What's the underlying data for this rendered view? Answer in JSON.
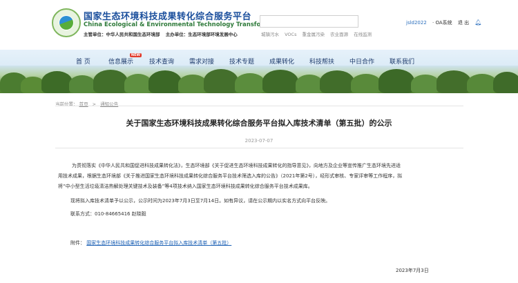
{
  "header": {
    "title_cn": "国家生态环境科技成果转化综合服务平台",
    "title_en": "China Ecological & Environmental Technology Transformation",
    "host_label": "主管单位：",
    "host_value": "中华人民共和国生态环境部",
    "organizer_label": "主办单位：",
    "organizer_value": "生态环境部环境发展中心",
    "search_placeholder": "",
    "hot_words": [
      "城镇污水",
      "VOCs",
      "重金属污染",
      "农业面源",
      "在线监测"
    ],
    "user": "jsld2022",
    "oa": "· OA系统",
    "logout": "退 出"
  },
  "nav": {
    "items": [
      "首 页",
      "信息展示",
      "技术查询",
      "需求对接",
      "技术专题",
      "成果转化",
      "科技帮扶",
      "中日合作",
      "联系我们"
    ],
    "new_badge": "NEW"
  },
  "breadcrumb": {
    "label": "当前位置：",
    "home": "首页",
    "arrow": ">",
    "current": "通知公告"
  },
  "article": {
    "title": "关于国家生态环境科技成果转化综合服务平台拟入库技术清单（第五批）的公示",
    "date": "2023-07-07",
    "p1_line1": "为贯彻落实《中华人民共和国促进科技成果转化法》，生态环境部《关于促进生态环境科技成果转化的指导意见》，向地方及企业等宣传推广生态环境先进适",
    "p1_line2": "用技术成果，根据生态环境部《关于推进国家生态环境科技成果转化综合服务平台技术筛选入库的公告》（2021年第2号），经形式审核、专家评审等工作程序，拟",
    "p1_line3": "将“中小型生活垃圾清洁热解处理关键技术及装备”等4项技术纳入国家生态环境科技成果转化综合服务平台技术成果库。",
    "p2": "现将拟入库技术清单予以公示，公示时间为2023年7月3日至7月14日。如有异议，请在公示期内以实名方式向平台反映。",
    "contact": "联系方式：010-84665416   赵晓毅",
    "attachment_label": "附件：",
    "attachment_link": "国家生态环境科技成果转化综合服务平台拟入库技术清单（第五批）",
    "sign_date": "2023年7月3日"
  }
}
